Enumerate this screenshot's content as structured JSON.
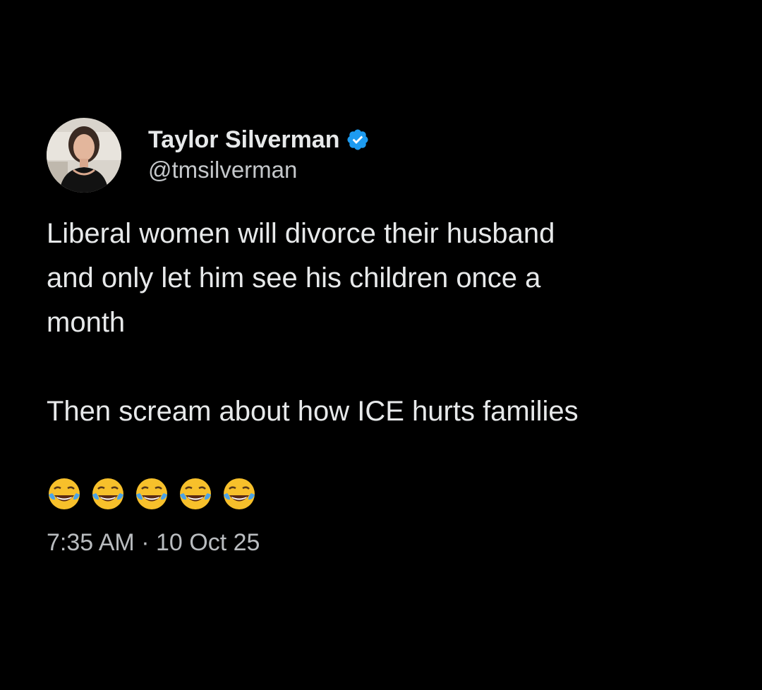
{
  "tweet": {
    "author": {
      "display_name": "Taylor Silverman",
      "handle": "@tmsilverman",
      "verified": true,
      "verified_color": "#1d9bf0"
    },
    "text": {
      "line1": "Liberal women will divorce their husband",
      "line2": "and only let him see his children once a",
      "line3": "month",
      "line4": "Then scream about how ICE hurts families"
    },
    "emojis": [
      "face-with-tears-of-joy",
      "face-with-tears-of-joy",
      "face-with-tears-of-joy",
      "face-with-tears-of-joy",
      "face-with-tears-of-joy"
    ],
    "timestamp": {
      "time": "7:35 AM",
      "separator": "·",
      "date": "10 Oct 25"
    }
  },
  "colors": {
    "background": "#000000",
    "text": "#e7e9ea",
    "muted": "#b9bcbf"
  }
}
